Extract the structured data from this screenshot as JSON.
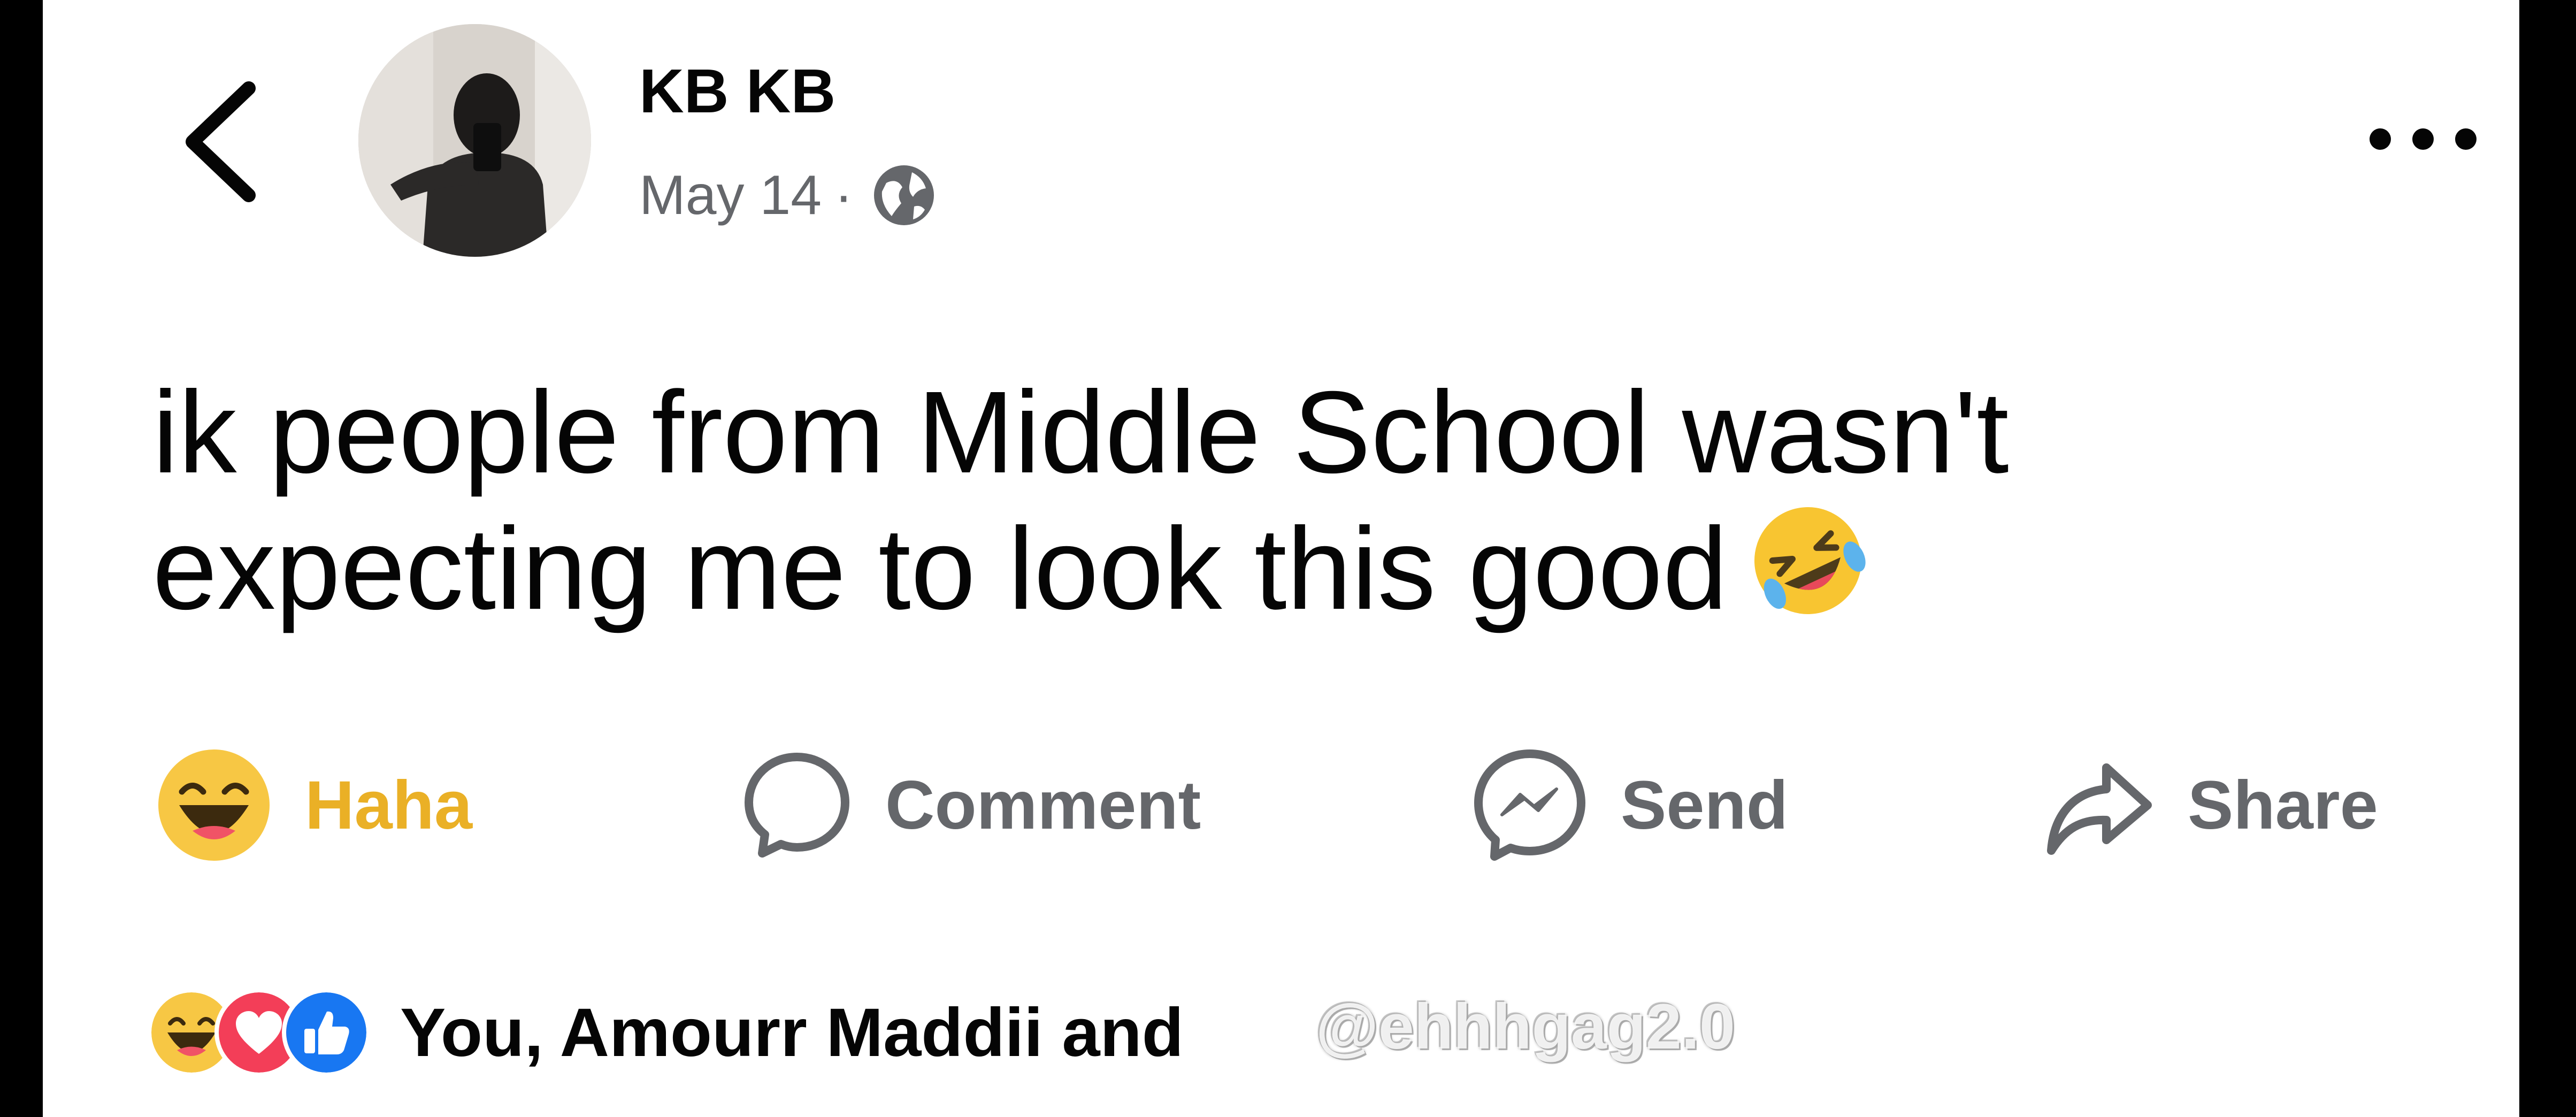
{
  "post": {
    "author": "KB KB",
    "date": "May 14",
    "separator": "·",
    "privacy_icon": "globe-icon",
    "text_line1": "ik people from Middle School wasn't",
    "text_line2": "expecting me to look this good",
    "emoji": "rolling-on-floor-laughing-emoji"
  },
  "actions": {
    "haha": "Haha",
    "comment": "Comment",
    "send": "Send",
    "share": "Share"
  },
  "reactions": {
    "icons": [
      "haha-icon",
      "love-icon",
      "like-icon"
    ],
    "summary": "You, Amourr Maddii and "
  },
  "watermark": "@ehhhgag2.0",
  "colors": {
    "haha_yellow": "#eab026",
    "love_red": "#f33e58",
    "like_blue": "#1877f2",
    "muted_text": "#65676b",
    "text": "#050505"
  }
}
